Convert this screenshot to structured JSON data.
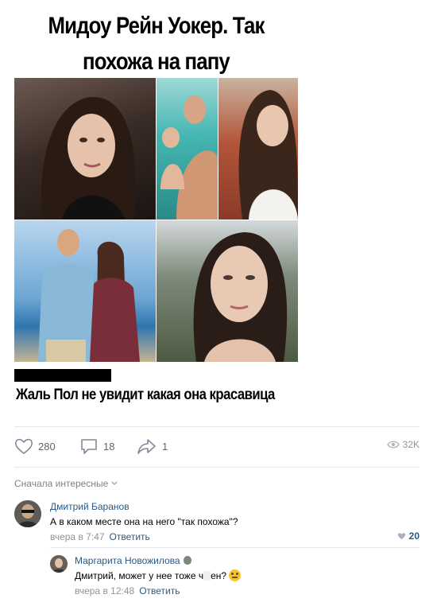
{
  "post": {
    "title_line1": "Мидоу Рейн Уокер. Так",
    "title_line2": "похожа на папу",
    "caption": "Жаль Пол не увидит какая она красавица"
  },
  "actions": {
    "likes": "280",
    "comments": "18",
    "shares": "1",
    "views": "32K"
  },
  "comments_section": {
    "sort_label": "Сначала интересные"
  },
  "comments": [
    {
      "author": "Дмитрий Баранов",
      "text": "А в каком месте она на него \"так похожа\"?",
      "time": "вчера в 7:47",
      "reply_label": "Ответить",
      "likes": "20"
    },
    {
      "author": "Маргарита Новожилова",
      "text_before": "Дмитрий, может у нее тоже ч",
      "text_after": "ен?",
      "time": "вчера в 12:48",
      "reply_label": "Ответить"
    }
  ],
  "colors": {
    "link": "#2a5885",
    "meta": "#939393",
    "separator": "#e7e8ec"
  }
}
